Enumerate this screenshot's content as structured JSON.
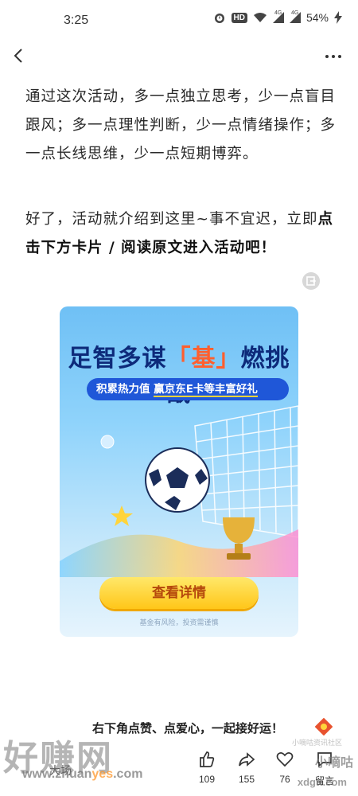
{
  "status": {
    "time": "3:25",
    "hd": "HD",
    "net1": "4G",
    "net2": "4G",
    "battery": "54%"
  },
  "nav": {
    "back_icon": "chevron-left-icon",
    "more_icon": "more-dots-icon"
  },
  "article": {
    "para1": "通过这次活动，多一点独立思考，少一点盲目跟风；多一点理性判断，少一点情绪操作；多一点长线思维，少一点短期博弈。",
    "para2_lead": "好了，活动就介绍到这里~事不宜迟，立即",
    "para2_bold": "点击下方卡片 / 阅读原文进入活动吧！"
  },
  "card": {
    "title_a": "足智多谋",
    "title_hl": "「基」",
    "title_b": "燃挑战",
    "subtitle_a": "积累热力值 ",
    "subtitle_hl": "赢京东E卡等丰富好礼",
    "button": "查看详情",
    "disclaimer": "基金有风险，投资需谨慎",
    "colors": {
      "bg": "#8fd3fb",
      "title": "#0d2a7a",
      "button": "#ffd43b"
    }
  },
  "footer": {
    "closing": "右下角点赞、点爱心，一起接好运！"
  },
  "actions": {
    "like_count": "109",
    "share_count": "155",
    "heart_count": "76",
    "comment_label": "留言"
  },
  "watermark": {
    "big": "好赚网",
    "url_a": "www.zhuan",
    "url_b": "yes",
    "url_c": ".com",
    "author": "大场",
    "corner": "小嘀咕",
    "corner_url": "xdgtt.com",
    "site": "小嘀咕资讯社区"
  }
}
